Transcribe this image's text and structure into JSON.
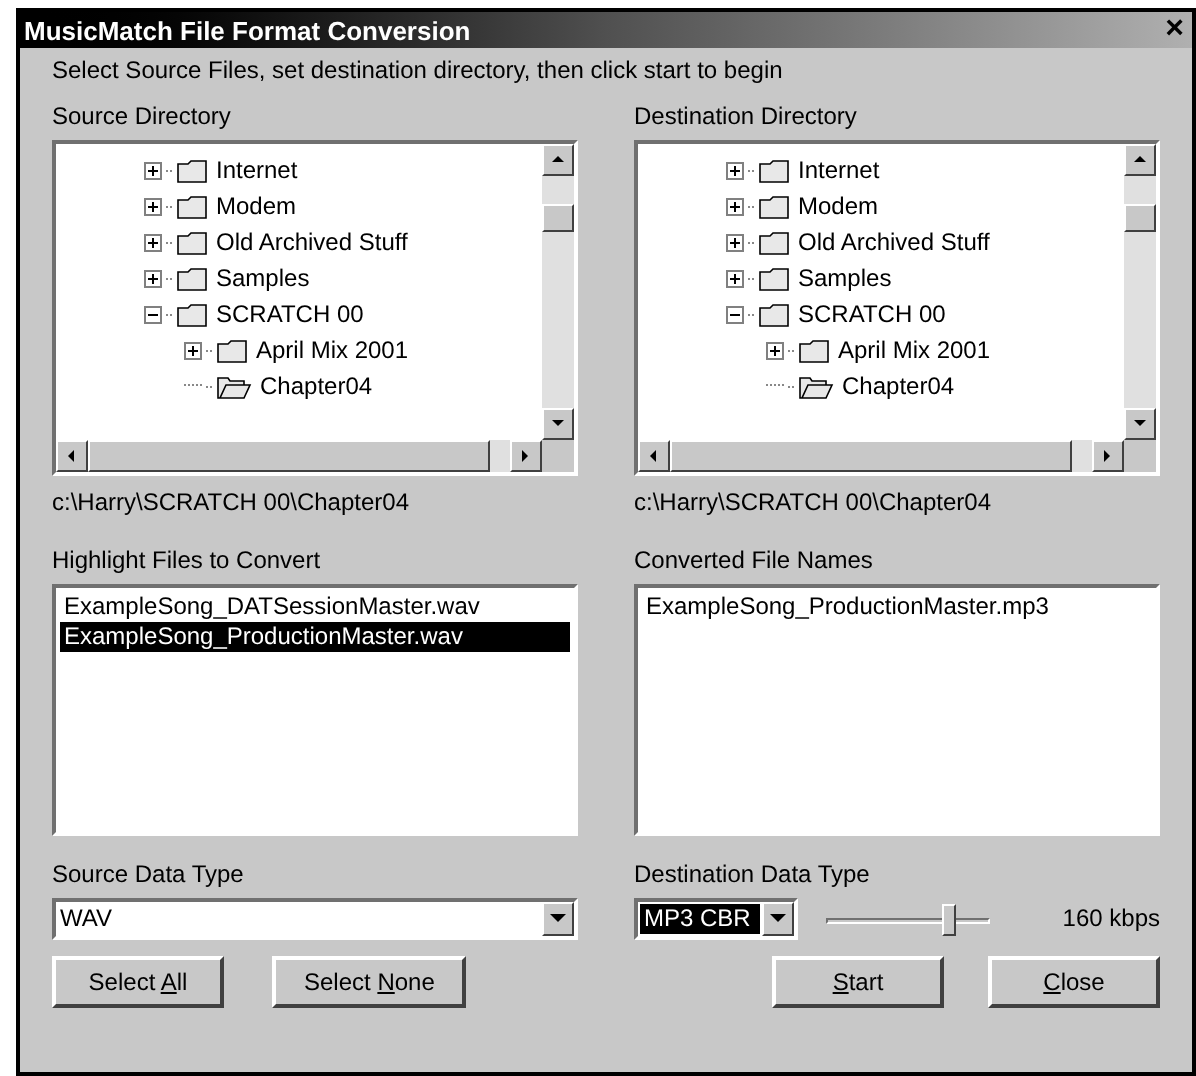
{
  "window": {
    "title": "MusicMatch File Format Conversion",
    "close": "×"
  },
  "instruction": "Select Source Files, set destination directory, then click start to begin",
  "source_directory": {
    "label": "Source Directory",
    "path": "c:\\Harry\\SCRATCH 00\\Chapter04",
    "tree": [
      {
        "label": "Internet",
        "expanded": false,
        "current": false
      },
      {
        "label": "Modem",
        "expanded": false,
        "current": false
      },
      {
        "label": "Old Archived Stuff",
        "expanded": false,
        "current": false
      },
      {
        "label": "Samples",
        "expanded": false,
        "current": false
      },
      {
        "label": "SCRATCH 00",
        "expanded": true,
        "current": false,
        "children": [
          {
            "label": "April Mix 2001",
            "expanded": false,
            "current": false
          },
          {
            "label": "Chapter04",
            "current": true
          }
        ]
      }
    ]
  },
  "destination_directory": {
    "label": "Destination Directory",
    "path": "c:\\Harry\\SCRATCH 00\\Chapter04",
    "tree": [
      {
        "label": "Internet",
        "expanded": false,
        "current": false
      },
      {
        "label": "Modem",
        "expanded": false,
        "current": false
      },
      {
        "label": "Old Archived Stuff",
        "expanded": false,
        "current": false
      },
      {
        "label": "Samples",
        "expanded": false,
        "current": false
      },
      {
        "label": "SCRATCH 00",
        "expanded": true,
        "current": false,
        "children": [
          {
            "label": "April Mix 2001",
            "expanded": false,
            "current": false
          },
          {
            "label": "Chapter04",
            "current": true
          }
        ]
      }
    ]
  },
  "source_files": {
    "label": "Highlight Files to Convert",
    "items": [
      {
        "label": "ExampleSong_DATSessionMaster.wav",
        "selected": false
      },
      {
        "label": "ExampleSong_ProductionMaster.wav",
        "selected": true
      }
    ]
  },
  "converted_files": {
    "label": "Converted File Names",
    "items": [
      {
        "label": "ExampleSong_ProductionMaster.mp3",
        "selected": false
      }
    ]
  },
  "source_type": {
    "label": "Source Data Type",
    "value": "WAV"
  },
  "destination_type": {
    "label": "Destination Data Type",
    "value": "MP3 CBR",
    "bitrate": {
      "level": 0.76,
      "reading": "160 kbps"
    }
  },
  "buttons": [
    {
      "before": "Select ",
      "key": "A",
      "after": "ll"
    },
    {
      "before": "Select ",
      "key": "N",
      "after": "one"
    },
    {
      "key": "S",
      "after": "tart"
    },
    {
      "key": "C",
      "after": "lose"
    }
  ]
}
